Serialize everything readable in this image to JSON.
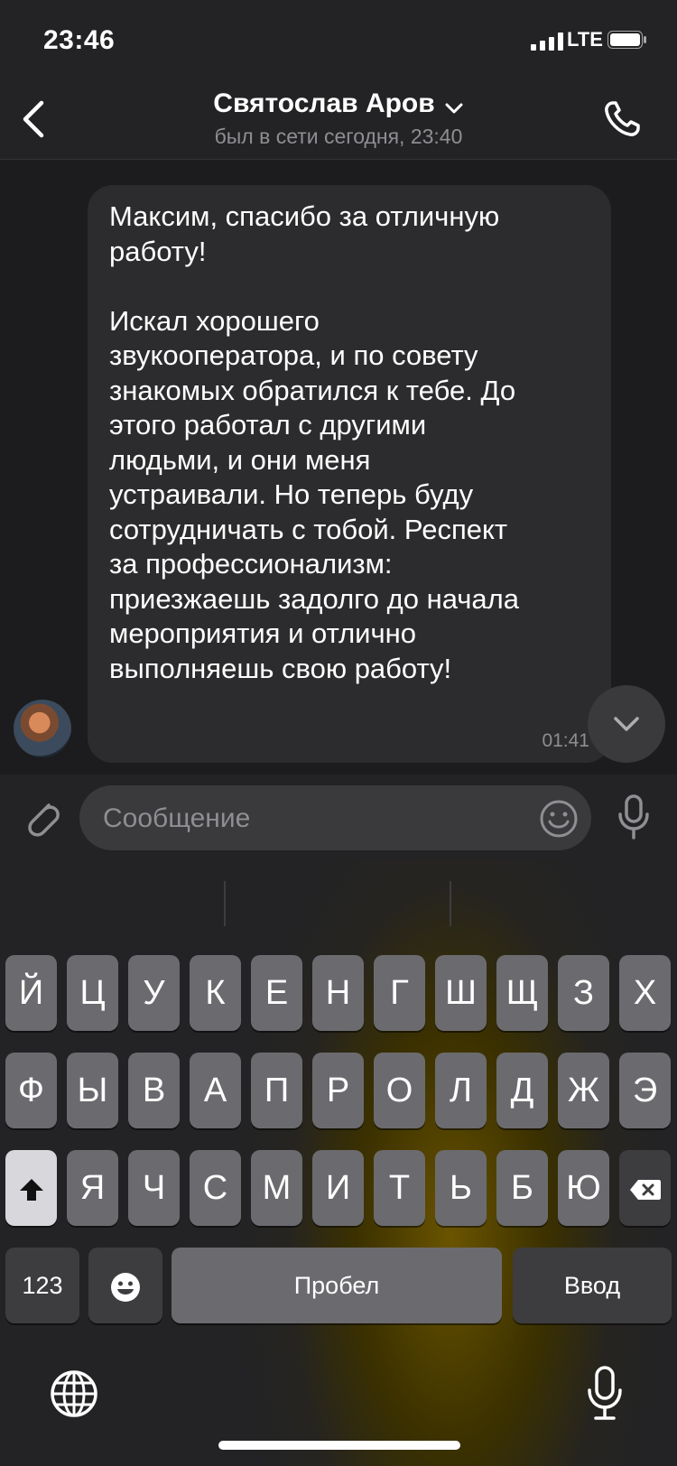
{
  "status": {
    "time": "23:46",
    "network": "LTE"
  },
  "header": {
    "title": "Святослав Аров",
    "subtitle": "был в сети сегодня, 23:40"
  },
  "message": {
    "text": "Максим, спасибо за отличную\nработу!\n\nИскал хорошего\nзвукооператора, и по совету\nзнакомых обратился к тебе. До\nэтого работал с другими\nлюдьми, и они меня\nустраивали. Но теперь буду\nсотрудничать с тобой. Респект\nза профессионализм:\nприезжаешь задолго до начала\nмероприятия и отлично\nвыполняешь свою работу!",
    "time": "01:41"
  },
  "composer": {
    "placeholder": "Сообщение"
  },
  "keyboard": {
    "row1": [
      "Й",
      "Ц",
      "У",
      "К",
      "Е",
      "Н",
      "Г",
      "Ш",
      "Щ",
      "З",
      "Х"
    ],
    "row2": [
      "Ф",
      "Ы",
      "В",
      "А",
      "П",
      "Р",
      "О",
      "Л",
      "Д",
      "Ж",
      "Э"
    ],
    "row3": [
      "Я",
      "Ч",
      "С",
      "М",
      "И",
      "Т",
      "Ь",
      "Б",
      "Ю"
    ],
    "numbers_label": "123",
    "space_label": "Пробел",
    "return_label": "Ввод"
  },
  "icons": {
    "back": "chevron-left-icon",
    "call": "phone-icon",
    "attach": "paperclip-icon",
    "emoji": "smile-icon",
    "voice": "microphone-icon",
    "scroll": "chevron-down-icon",
    "globe": "globe-icon",
    "dictation": "microphone-icon",
    "shift": "shift-icon",
    "delete": "backspace-icon"
  }
}
